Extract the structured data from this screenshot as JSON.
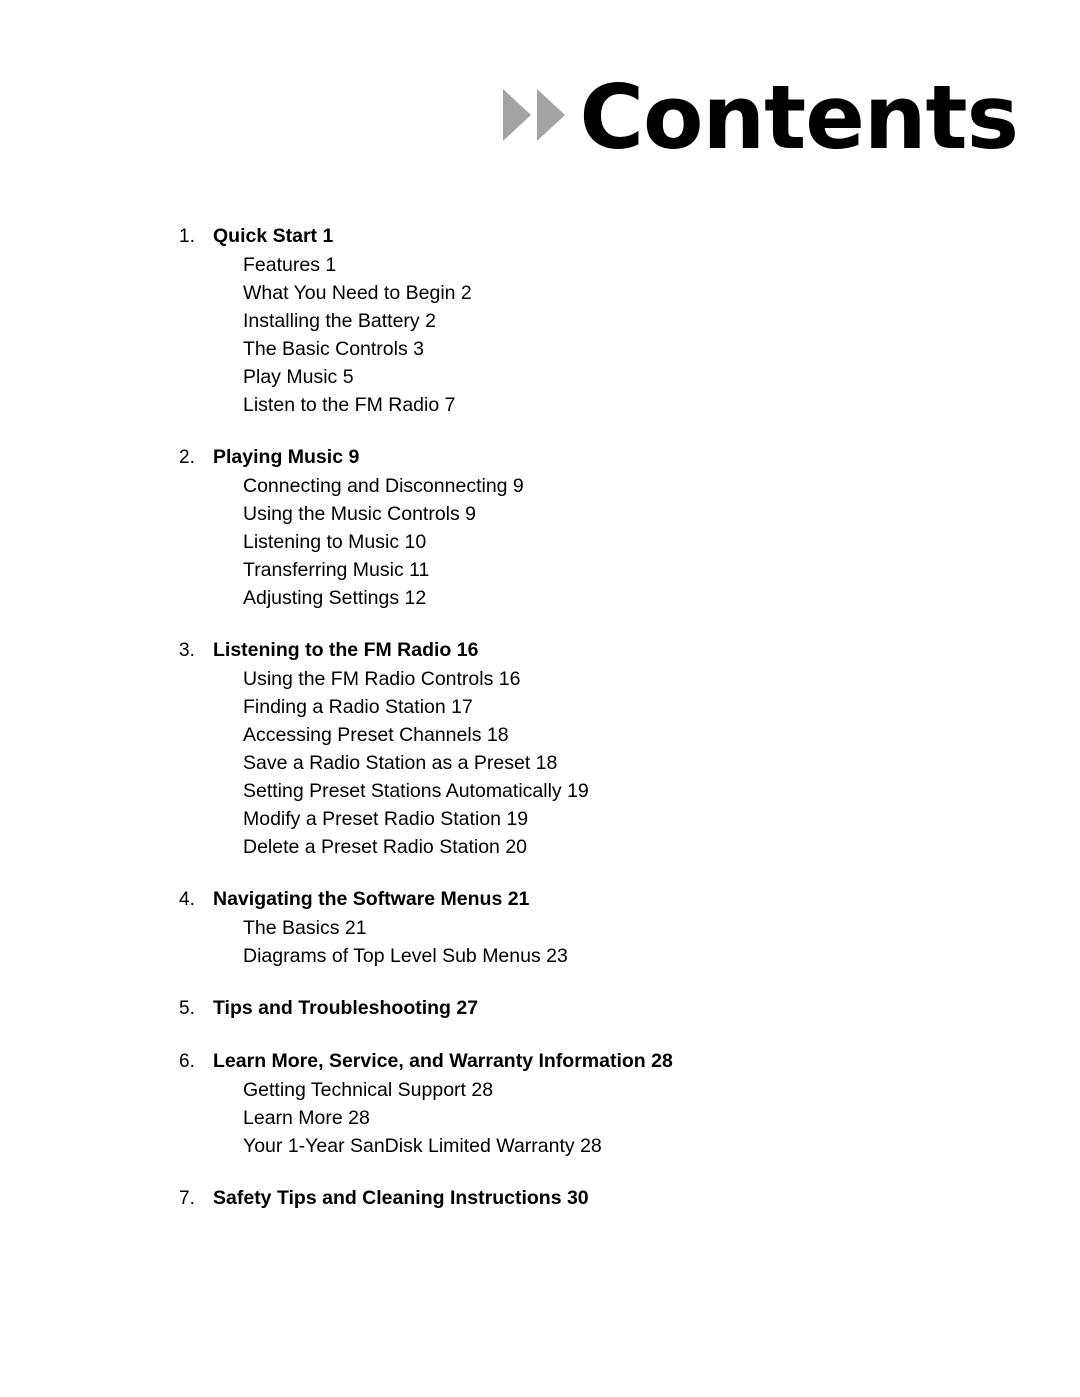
{
  "document": {
    "title": "Contents",
    "title_icon": "double-play-arrow-icon",
    "arrow_color": "#a3a3a3",
    "text_color": "#000000",
    "background_color": "#ffffff"
  },
  "toc": {
    "sections": [
      {
        "number": "1.",
        "title": "Quick Start 1",
        "entries": [
          "Features 1",
          "What You Need to Begin 2",
          "Installing the Battery 2",
          "The Basic Controls 3",
          "Play Music 5",
          "Listen to the FM Radio 7"
        ]
      },
      {
        "number": "2.",
        "title": "Playing Music 9",
        "entries": [
          "Connecting and Disconnecting 9",
          "Using the Music Controls 9",
          "Listening to Music 10",
          "Transferring Music 11",
          "Adjusting Settings 12"
        ]
      },
      {
        "number": "3.",
        "title": "Listening to the FM Radio 16",
        "entries": [
          "Using the FM Radio Controls 16",
          "Finding a Radio Station 17",
          "Accessing Preset Channels 18",
          "Save a Radio Station as a Preset 18",
          "Setting Preset Stations Automatically 19",
          "Modify a Preset Radio Station 19",
          "Delete a Preset Radio Station 20"
        ]
      },
      {
        "number": "4.",
        "title": "Navigating the Software Menus 21",
        "entries": [
          "The Basics 21",
          "Diagrams of Top Level Sub Menus 23"
        ]
      },
      {
        "number": "5.",
        "title": "Tips and Troubleshooting 27",
        "entries": []
      },
      {
        "number": "6.",
        "title": "Learn More, Service, and Warranty Information 28",
        "entries": [
          "Getting Technical Support 28",
          "Learn More 28",
          "Your 1-Year SanDisk Limited Warranty 28"
        ]
      },
      {
        "number": "7.",
        "title": "Safety Tips and Cleaning Instructions 30",
        "entries": []
      }
    ]
  }
}
